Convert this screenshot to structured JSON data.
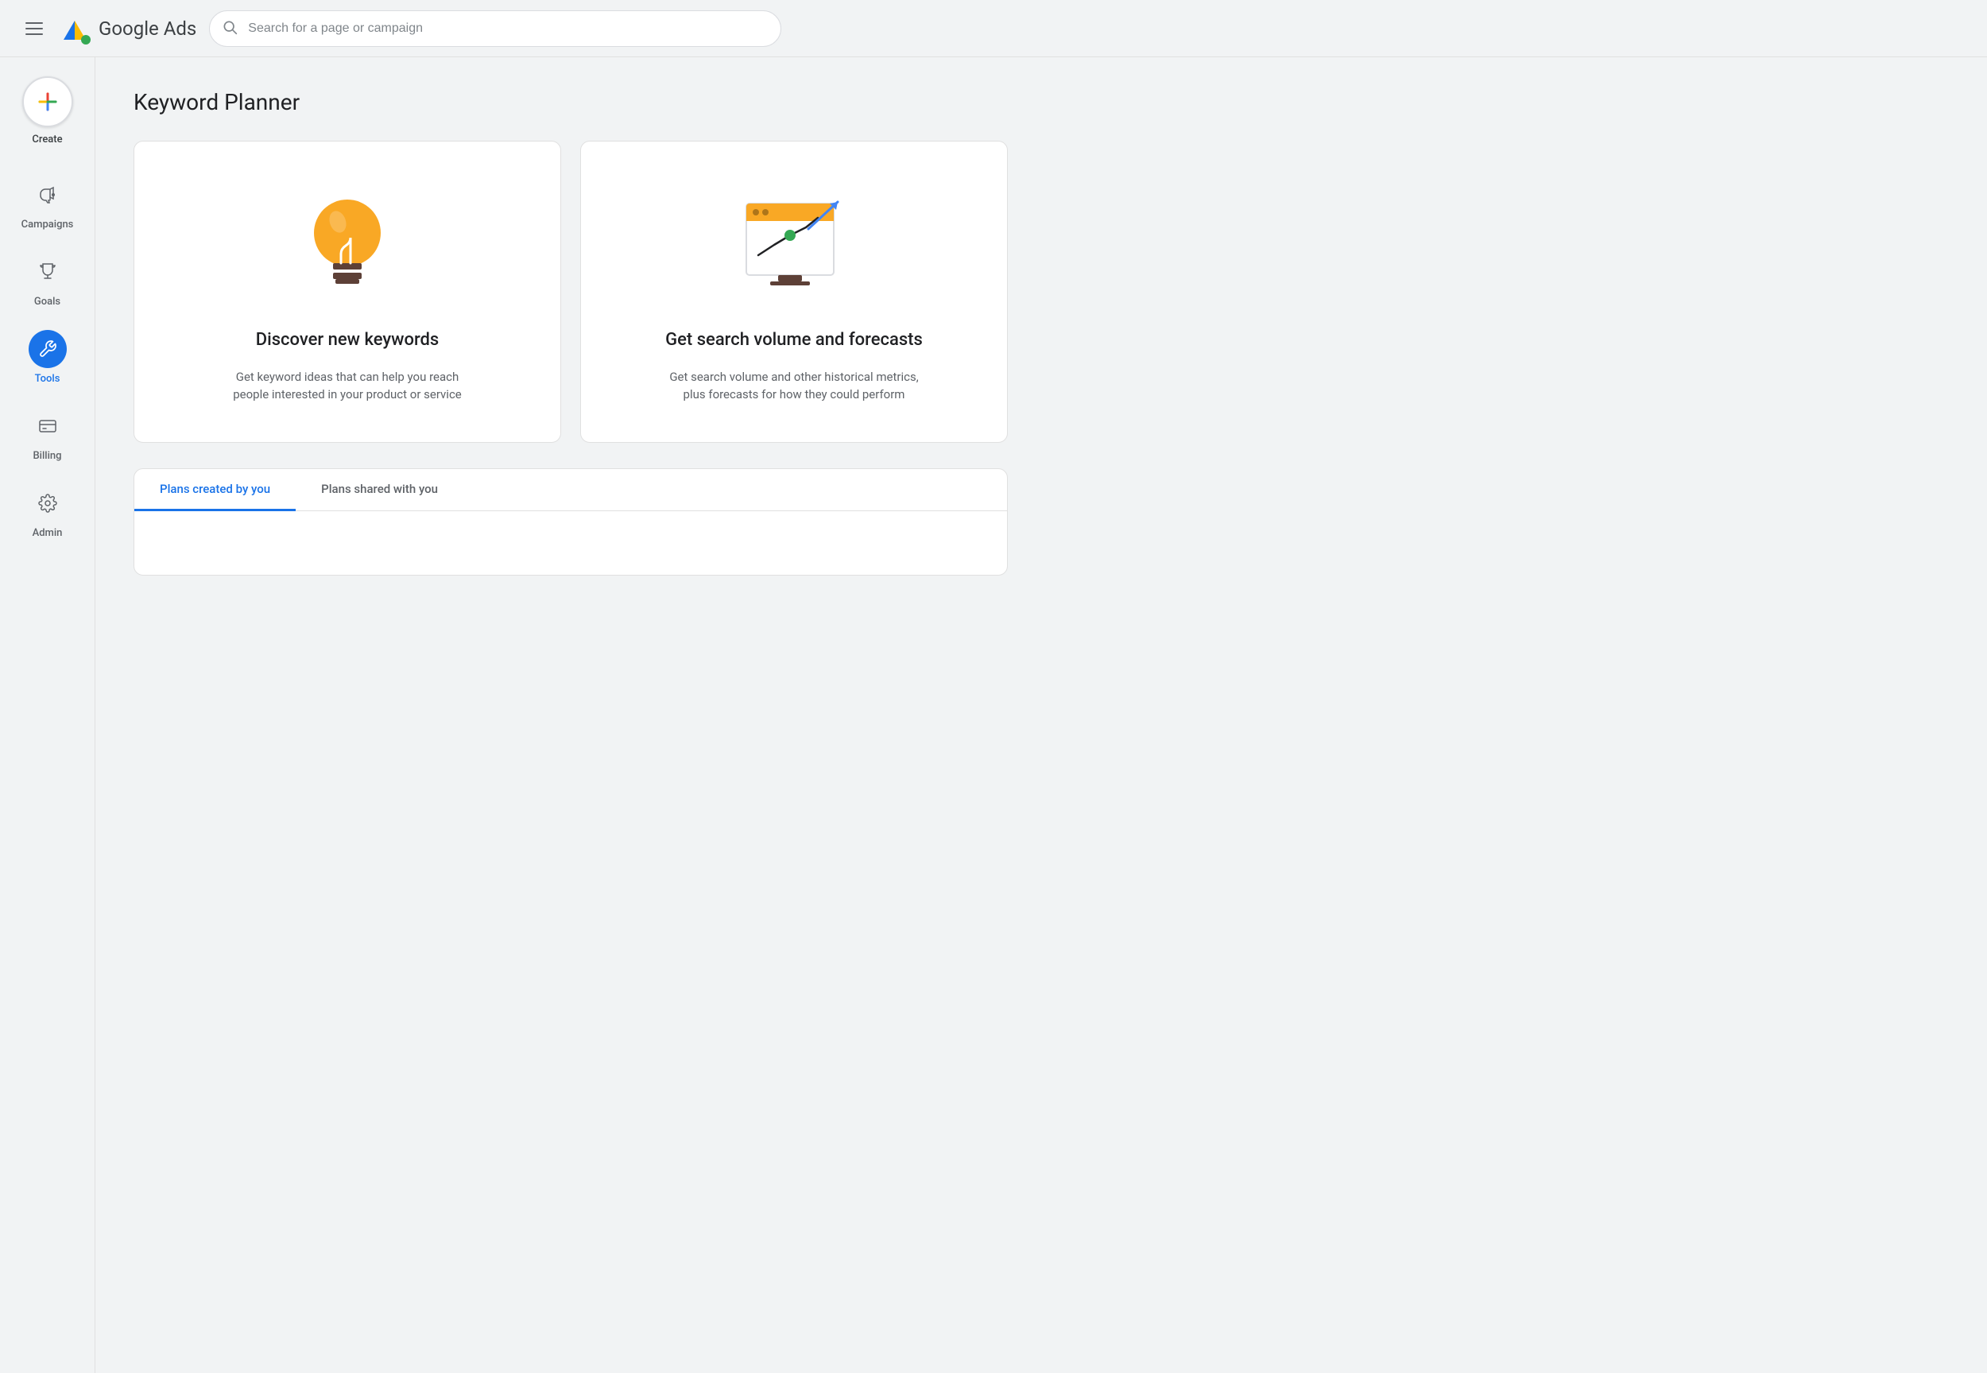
{
  "topnav": {
    "app_title": "Google Ads",
    "search_placeholder": "Search for a page or campaign"
  },
  "sidebar": {
    "create_label": "Create",
    "items": [
      {
        "id": "campaigns",
        "label": "Campaigns",
        "active": false
      },
      {
        "id": "goals",
        "label": "Goals",
        "active": false
      },
      {
        "id": "tools",
        "label": "Tools",
        "active": true
      },
      {
        "id": "billing",
        "label": "Billing",
        "active": false
      },
      {
        "id": "admin",
        "label": "Admin",
        "active": false
      }
    ]
  },
  "main": {
    "page_title": "Keyword Planner",
    "cards": [
      {
        "id": "discover",
        "title": "Discover new keywords",
        "description": "Get keyword ideas that can help you reach people interested in your product or service"
      },
      {
        "id": "forecasts",
        "title": "Get search volume and forecasts",
        "description": "Get search volume and other historical metrics, plus forecasts for how they could perform"
      }
    ],
    "tabs": [
      {
        "id": "created-by-you",
        "label": "Plans created by you",
        "active": true
      },
      {
        "id": "shared-with-you",
        "label": "Plans shared with you",
        "active": false
      }
    ]
  },
  "colors": {
    "google_blue": "#1a73e8",
    "google_red": "#ea4335",
    "google_yellow": "#fbbc04",
    "google_green": "#34a853",
    "bulb_orange": "#f9a825",
    "chart_yellow": "#f9a825"
  }
}
